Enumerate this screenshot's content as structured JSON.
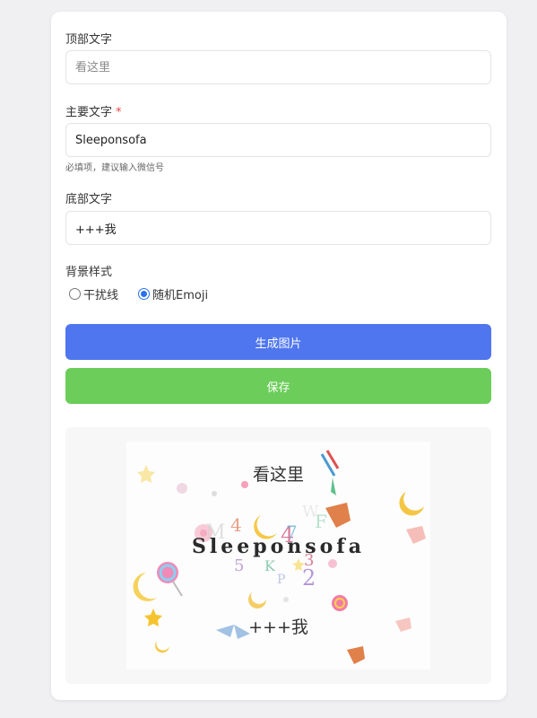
{
  "form": {
    "top_text": {
      "label": "顶部文字",
      "value": "",
      "placeholder": "看这里"
    },
    "main_text": {
      "label": "主要文字",
      "required_mark": "*",
      "value": "Sleeponsofa",
      "hint": "必填项，建议输入微信号"
    },
    "bottom_text": {
      "label": "底部文字",
      "value": "+++我"
    },
    "background": {
      "label": "背景样式",
      "options": [
        {
          "label": "干扰线",
          "selected": false
        },
        {
          "label": "随机Emoji",
          "selected": true
        }
      ]
    }
  },
  "buttons": {
    "generate": {
      "label": "生成图片",
      "color": "#4f76ee"
    },
    "save": {
      "label": "保存",
      "color": "#6ccd5a"
    }
  },
  "preview": {
    "top": "看这里",
    "main": "Sleeponsofa",
    "bottom": "+++我",
    "noise_chars": [
      "4",
      "M",
      "4",
      "7",
      "W",
      "F",
      "5",
      "K",
      "3",
      "2",
      "P"
    ]
  }
}
